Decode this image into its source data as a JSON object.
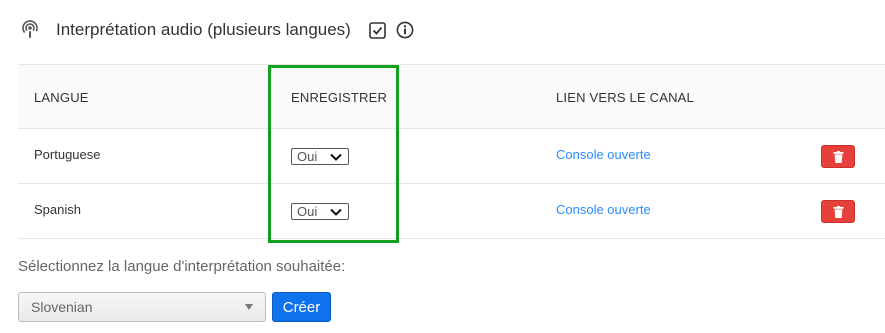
{
  "header": {
    "title": "Interprétation audio (plusieurs langues)"
  },
  "table": {
    "columns": [
      "LANGUE",
      "ENREGISTRER",
      "LIEN VERS LE CANAL"
    ],
    "rows": [
      {
        "language": "Portuguese",
        "record": "Oui",
        "link": "Console ouverte"
      },
      {
        "language": "Spanish",
        "record": "Oui",
        "link": "Console ouverte"
      }
    ]
  },
  "add": {
    "prompt": "Sélectionnez la langue d'interprétation souhaitée:",
    "selected_language": "Slovenian",
    "create_label": "Créer"
  },
  "colors": {
    "link": "#2d8cff",
    "delete": "#e5413a",
    "primary": "#0e72ed",
    "highlight": "#12a01e"
  }
}
